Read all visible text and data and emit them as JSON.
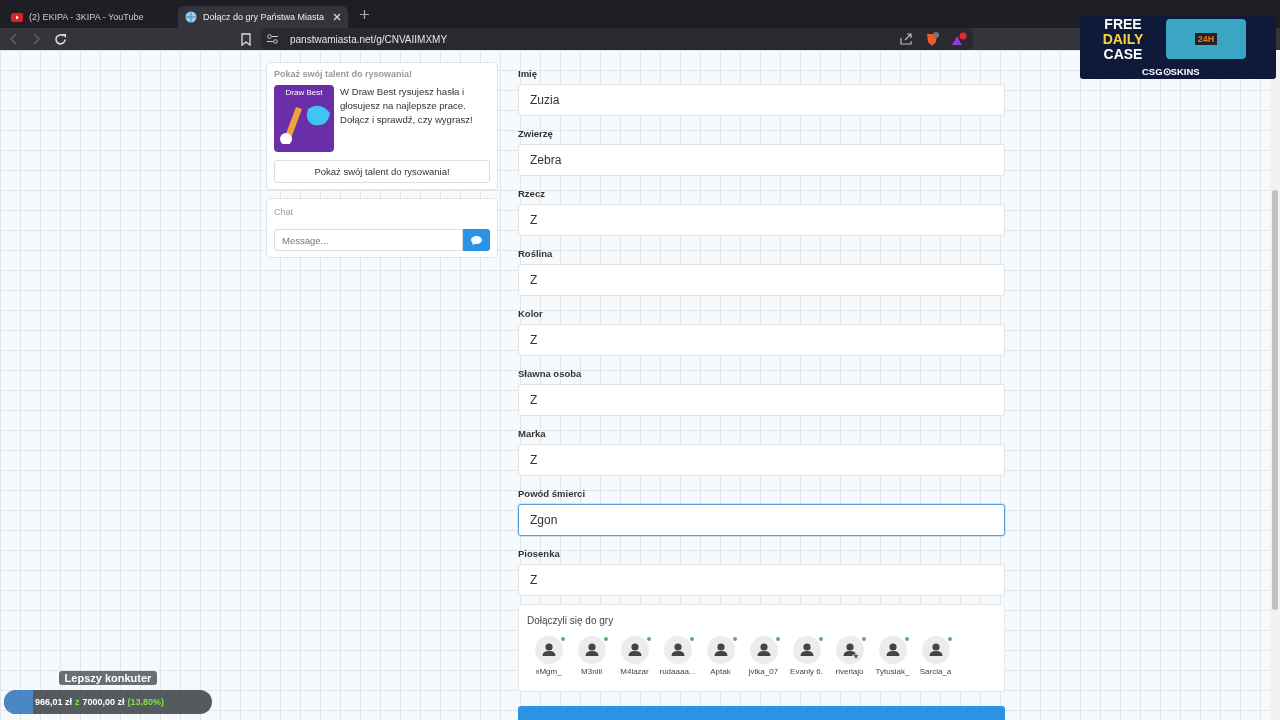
{
  "browser": {
    "tabs": [
      {
        "title": "(2) EKIPA - 3KIPA - YouTube",
        "kind": "video",
        "selected": false
      },
      {
        "title": "Dołącz do gry Państwa Miasta",
        "kind": "globe",
        "selected": true
      }
    ],
    "url": "panstwamiasta.net/g/CNVAIIMXMY"
  },
  "promo": {
    "heading": "Pokaż swój talent do rysowania!",
    "image_title": "Draw Best",
    "text": "W Draw Best rysujesz hasła i głosujesz na najlepsze prace. Dołącz i sprawdź, czy wygrasz!",
    "button": "Pokaż swój talent do rysowania!"
  },
  "chat": {
    "title": "Chat",
    "placeholder": "Message..."
  },
  "fields": [
    {
      "label": "Imię",
      "value": "Zuzia",
      "focused": false
    },
    {
      "label": "Zwierzę",
      "value": "Zebra",
      "focused": false
    },
    {
      "label": "Rzecz",
      "value": "Z",
      "focused": false
    },
    {
      "label": "Roślina",
      "value": "Z",
      "focused": false
    },
    {
      "label": "Kolor",
      "value": "Z",
      "focused": false
    },
    {
      "label": "Sławna osoba",
      "value": "Z",
      "focused": false
    },
    {
      "label": "Marka",
      "value": "Z",
      "focused": false
    },
    {
      "label": "Powód śmierci",
      "value": "Zgon",
      "focused": true
    },
    {
      "label": "Piosenka",
      "value": "Z",
      "focused": false
    }
  ],
  "players": {
    "title": "Dołączyli się do gry",
    "items": [
      {
        "name": "xMgm_",
        "online": true,
        "host": false
      },
      {
        "name": "M3niii",
        "online": true,
        "host": false
      },
      {
        "name": "M4lazar",
        "online": true,
        "host": false
      },
      {
        "name": "rudaaaa...",
        "online": true,
        "host": false
      },
      {
        "name": "Aptak",
        "online": true,
        "host": false
      },
      {
        "name": "jvlka_07",
        "online": true,
        "host": false
      },
      {
        "name": "Evanly 6.",
        "online": true,
        "host": false
      },
      {
        "name": "riverlajo",
        "online": true,
        "host": true
      },
      {
        "name": "Tytusiak_",
        "online": true,
        "host": false
      },
      {
        "name": "Sarcia_a",
        "online": true,
        "host": false
      }
    ]
  },
  "ad": {
    "line1": "FREE",
    "line2": "DAILY",
    "line3": "CASE",
    "badge": "24H",
    "brand": "CSG⊙SKINS"
  },
  "goal": {
    "title": "Lepszy konkuter",
    "raised": "966,01 zł",
    "separator": "z",
    "target": "7000,00 zł",
    "percent": "(13.80%)",
    "level": 0.138
  }
}
